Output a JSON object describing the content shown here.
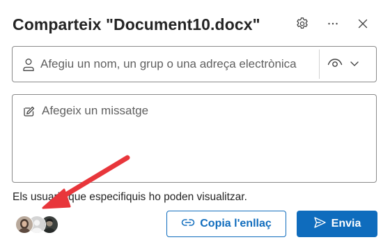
{
  "dialog": {
    "title": "Comparteix \"Document10.docx\"",
    "header_icons": [
      "gear-icon",
      "more-icon",
      "close-icon"
    ]
  },
  "share_input": {
    "placeholder": "Afegiu un nom, un grup o una adreça electrònica",
    "value": "",
    "icon": "person-icon",
    "permission_icons": [
      "eye-icon",
      "chevron-down-icon"
    ]
  },
  "message": {
    "placeholder": "Afegeix un missatge",
    "value": "",
    "icon": "edit-icon"
  },
  "info": {
    "text": "Els usuaris que especifiquis ho poden visualitzar."
  },
  "avatars": {
    "count": 3
  },
  "buttons": {
    "copy_link_label": "Copia l'enllaç",
    "send_label": "Envia"
  },
  "colors": {
    "accent": "#0f6cbd",
    "annotation_arrow": "#e8363b",
    "border": "#8a8a8a",
    "text": "#242424"
  }
}
